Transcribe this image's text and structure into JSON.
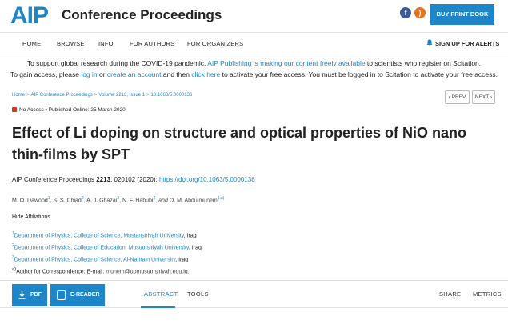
{
  "header": {
    "logo": "AIP",
    "title": "Conference Proceedings",
    "facebook_icon": "facebook-icon",
    "rss_icon": "rss-icon",
    "buy_label": "BUY PRINT BOOK",
    "accent": "#1e86c8"
  },
  "nav": {
    "items": [
      "HOME",
      "BROWSE",
      "INFO",
      "FOR AUTHORS",
      "FOR ORGANIZERS"
    ],
    "signup": "SIGN UP FOR ALERTS"
  },
  "notice": {
    "l1_a": "To support global research during the COVID-19 pandemic, ",
    "l1_link": "AIP Publishing is making our content freely available",
    "l1_b": " to scientists who register on Scitation.",
    "l2_a": "To gain access, please ",
    "l2_login": "log in",
    "l2_b": " or ",
    "l2_create": "create an account",
    "l2_c": " and then ",
    "l2_click": "click here",
    "l2_d": " to activate your free access. You must be logged in to Scitation to activate your free access."
  },
  "breadcrumb": [
    "Home",
    "AIP Conference Proceedings",
    "Volume 2213, Issue 1",
    "10.1063/5.0000136"
  ],
  "pager": {
    "prev": "‹ PREV",
    "next": "NEXT ›"
  },
  "access": {
    "label": "No Access",
    "published": "Published Online: 25 March 2020"
  },
  "article": {
    "title": "Effect of Li doping on structure and optical properties of NiO nano thin-films by SPT",
    "citation_journal": "AIP Conference Proceedings ",
    "citation_volume": "2213",
    "citation_rest": ", 020102 (2020); ",
    "doi": "https://doi.org/10.1063/5.0000136"
  },
  "authors": [
    {
      "name": "M. O. Dawood",
      "sup": "1"
    },
    {
      "name": "S. S. Chiad",
      "sup": "2"
    },
    {
      "name": "A. J. Ghazai",
      "sup": "3"
    },
    {
      "name": "N. F. Habubi",
      "sup": "2"
    },
    {
      "name": "O. M. Abdulmunem",
      "sup": "1,a)"
    }
  ],
  "authors_and": "and",
  "hide_affiliations": "Hide Affiliations",
  "affiliations": [
    {
      "sup": "1",
      "dept": "Department of Physics, College of Science, Mustansiriyah University",
      "rest": ", Iraq"
    },
    {
      "sup": "2",
      "dept": "Department of Physics, College of Education, Mustansiriyah University",
      "rest": ", Iraq"
    },
    {
      "sup": "3",
      "dept": "Department of Physics, College of Science, Al-Nahrain University",
      "rest": ", Iraq"
    }
  ],
  "correspondence": {
    "sup": "a)",
    "label": "Author for Correspondence: E-mail: ",
    "email": "munem@uomustansiriyah.edu.iq."
  },
  "tools": {
    "pdf": "PDF",
    "ereader": "E-READER",
    "tabs": [
      "ABSTRACT",
      "TOOLS"
    ],
    "share": "SHARE",
    "metrics": "METRICS"
  }
}
